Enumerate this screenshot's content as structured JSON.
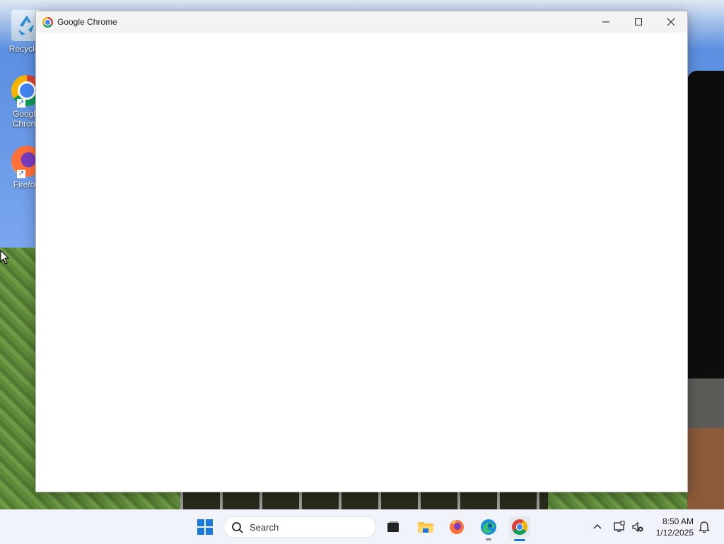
{
  "desktop": {
    "icons": [
      {
        "label": "Recycle",
        "icon": "recycle-bin-icon"
      },
      {
        "label": "Googl\nChron",
        "icon": "chrome-icon"
      },
      {
        "label": "Firefo",
        "icon": "firefox-icon"
      }
    ]
  },
  "window": {
    "title": "Google Chrome",
    "title_icon": "chrome-icon",
    "controls": [
      "minimize-icon",
      "maximize-icon",
      "close-icon"
    ]
  },
  "taskbar": {
    "search_label": "Search",
    "pinned": [
      "start-icon",
      "task-view-icon",
      "file-explorer-icon",
      "firefox-icon",
      "edge-icon",
      "chrome-icon"
    ],
    "tray": [
      "chevron-up-icon",
      "network-icon",
      "volume-muted-icon",
      "notification-bell-icon"
    ],
    "time": "8:50 AM",
    "date": "1/12/2025"
  },
  "colors": {
    "accent": "#1a73e8",
    "taskbar_bg": "#f0f3f9",
    "titlebar_bg": "#f3f3f3"
  }
}
